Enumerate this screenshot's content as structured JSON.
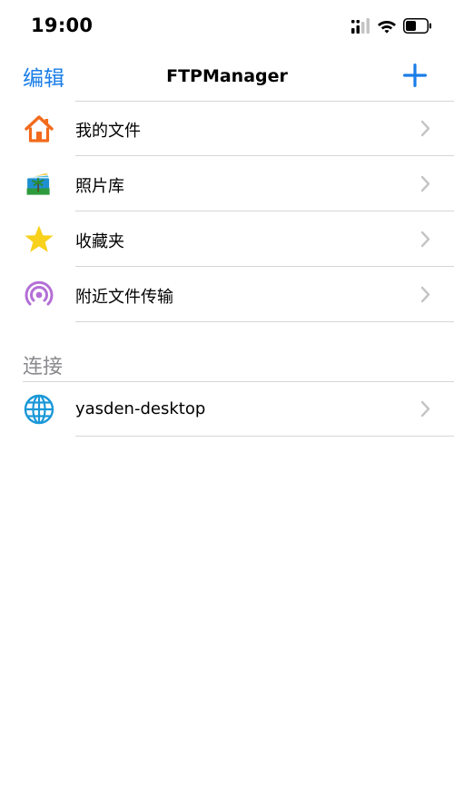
{
  "status_bar": {
    "time": "19:00"
  },
  "nav": {
    "edit_label": "编辑",
    "title": "FTPManager",
    "add_icon": "plus-icon"
  },
  "accent_color": "#1a7de8",
  "items": [
    {
      "label": "我的文件",
      "icon": "home-icon"
    },
    {
      "label": "照片库",
      "icon": "photos-icon"
    },
    {
      "label": "收藏夹",
      "icon": "star-icon"
    },
    {
      "label": "附近文件传输",
      "icon": "airdrop-icon"
    }
  ],
  "connections_section": {
    "title": "连接",
    "items": [
      {
        "label": "yasden-desktop",
        "icon": "globe-icon"
      }
    ]
  }
}
